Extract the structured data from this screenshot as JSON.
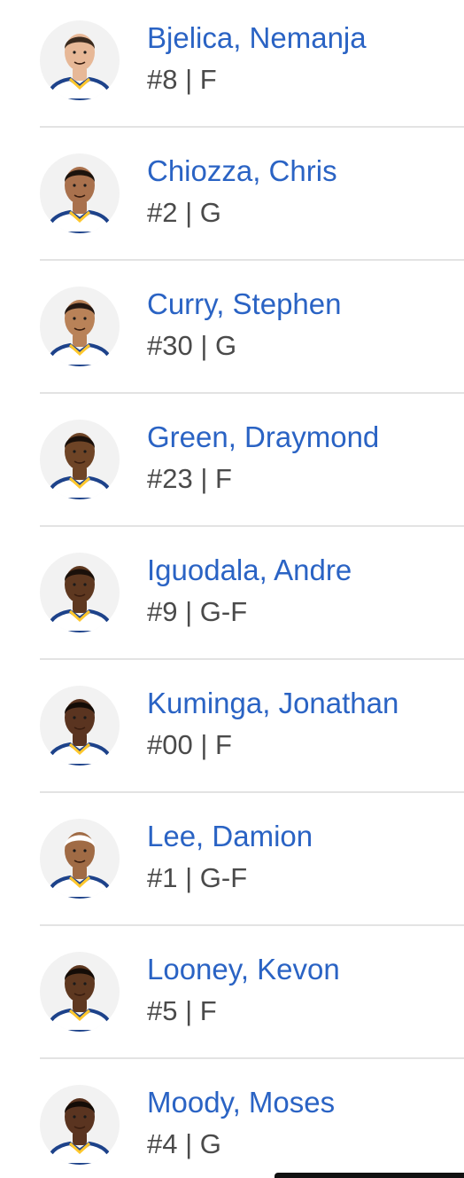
{
  "colors": {
    "name_link": "#2a63c4",
    "meta_text": "#4a4a4a",
    "divider": "#e3e3e3",
    "jersey_blue": "#1d428a",
    "jersey_gold": "#ffc72c"
  },
  "players": [
    {
      "name": "Bjelica, Nemanja",
      "meta": "#8 | F",
      "skin": "#e7b897",
      "hair": "#3a2a1e",
      "avatar_icon": "player-headshot-icon"
    },
    {
      "name": "Chiozza, Chris",
      "meta": "#2 | G",
      "skin": "#a9714d",
      "hair": "#1c130d",
      "avatar_icon": "player-headshot-icon"
    },
    {
      "name": "Curry, Stephen",
      "meta": "#30 | G",
      "skin": "#b98258",
      "hair": "#241711",
      "avatar_icon": "player-headshot-icon"
    },
    {
      "name": "Green, Draymond",
      "meta": "#23 | F",
      "skin": "#6e4426",
      "hair": "#1a100a",
      "avatar_icon": "player-headshot-icon"
    },
    {
      "name": "Iguodala, Andre",
      "meta": "#9 | G-F",
      "skin": "#5e3820",
      "hair": "#1a100a",
      "avatar_icon": "player-headshot-icon"
    },
    {
      "name": "Kuminga, Jonathan",
      "meta": "#00 | F",
      "skin": "#5a3420",
      "hair": "#140c07",
      "avatar_icon": "player-headshot-icon"
    },
    {
      "name": "Lee, Damion",
      "meta": "#1 | G-F",
      "skin": "#a06b45",
      "hair": "#ffffff",
      "avatar_icon": "player-headshot-icon"
    },
    {
      "name": "Looney, Kevon",
      "meta": "#5 | F",
      "skin": "#5e3820",
      "hair": "#140c07",
      "avatar_icon": "player-headshot-icon"
    },
    {
      "name": "Moody, Moses",
      "meta": "#4 | G",
      "skin": "#5a3420",
      "hair": "#140c07",
      "avatar_icon": "player-headshot-icon"
    }
  ]
}
